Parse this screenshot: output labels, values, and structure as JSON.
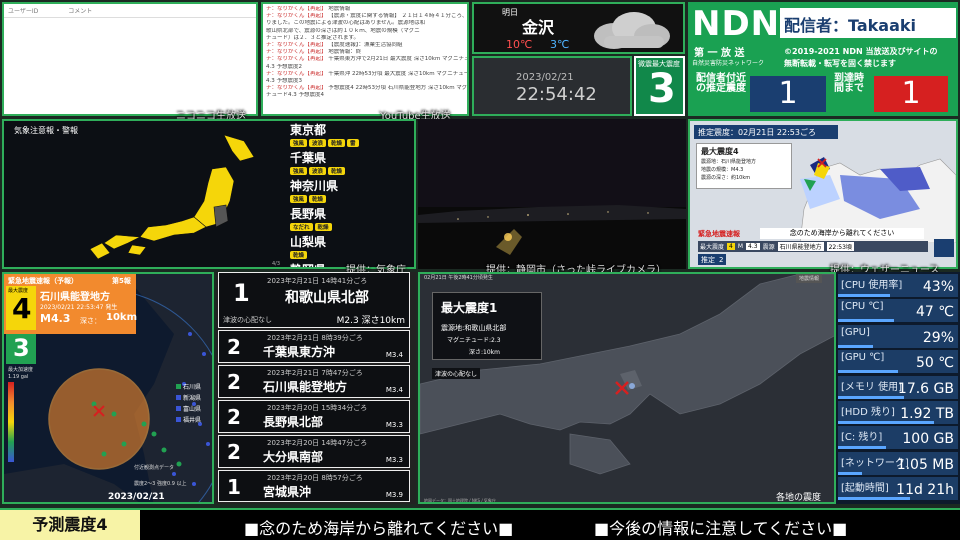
{
  "colors": {
    "frame": "#2fae5a",
    "ndn_green": "#1aa152",
    "alert_red": "#d62020",
    "quake_yellow": "#f5d60a",
    "navy": "#1a3e70"
  },
  "niconico": {
    "col_user": "ユーザーID",
    "col_comment": "コメント",
    "label": "ニコニコ生放送"
  },
  "youtube": {
    "label": "YouTube生放送",
    "messages": [
      {
        "who": "ナ：なりかくん【再起】",
        "msg": "地震情報"
      },
      {
        "who": "ナ：なりかくん【再起】",
        "msg": "【震源・震度に関する情報】 ２１日１４時４１分ごろ、地震があ"
      },
      {
        "who": "",
        "msg": "りました。この地震による津波の心配はありません。震源地は和"
      },
      {
        "who": "",
        "msg": "歌山県北部で、震源の深さは約１０ｋｍ、地震の規模（マグニ"
      },
      {
        "who": "",
        "msg": "チュード）は２．３と推定されます。"
      },
      {
        "who": "ナ：なりかくん【再起】",
        "msg": "【震度速報】：漁業生活協同組"
      },
      {
        "who": "ナ：なりかくん【再起】",
        "msg": "地震情報：終"
      },
      {
        "who": "ナ：なりかくん【再起】",
        "msg": "千葉県東方沖で2月21日 最大震度 深さ10km マグニチュード"
      },
      {
        "who": "",
        "msg": "4.3 予想震度2"
      },
      {
        "who": "ナ：なりかくん【再起】",
        "msg": "千葉県沖 22時53分頃 最大震度 深さ10km マグニチュード"
      },
      {
        "who": "",
        "msg": "4.3 予想震度3"
      },
      {
        "who": "ナ：なりかくん【再起】",
        "msg": "予想震度4 22時53分頃 石川県能登地方 深さ10km マグニ"
      },
      {
        "who": "",
        "msg": "チュード4.3 予想震度4"
      }
    ]
  },
  "weather": {
    "label": "明日",
    "city": "金沢",
    "high": "10℃",
    "low": "3℃"
  },
  "clock": {
    "date": "2023/02/21",
    "time": "22:54:42",
    "seismic_label": "微震最大震度",
    "seismic_value": "3"
  },
  "ndn": {
    "logo": "NDN",
    "broadcaster": "配信者：Takaaki",
    "subtitle": "第 一 放 送",
    "network": "自然災害防災ネットワーク",
    "copyright_1": "©2019-2021 NDN 当放送及びサイトの",
    "copyright_2": "無断転載・転写を固く禁じます",
    "near_label": "配信者付近の推定震度",
    "near_value": "1",
    "arrival_label": "到達時間まで",
    "arrival_value": "1"
  },
  "jma_map": {
    "title": "気象注意報・警報",
    "page": "4/3",
    "credit": "提供：気象庁",
    "prefs": [
      {
        "name": "東京都",
        "chips": [
          "強風",
          "波浪",
          "乾燥",
          "雷"
        ]
      },
      {
        "name": "千葉県",
        "chips": [
          "強風",
          "波浪",
          "乾燥"
        ]
      },
      {
        "name": "神奈川県",
        "chips": [
          "強風",
          "乾燥"
        ]
      },
      {
        "name": "長野県",
        "chips": [
          "なだれ",
          "乾燥"
        ]
      },
      {
        "name": "山梨県",
        "chips": [
          "乾燥"
        ]
      },
      {
        "name": "静岡県",
        "chips": [
          "乾燥"
        ]
      }
    ]
  },
  "live_camera": {
    "credit": "提供：静岡市（さった峠ライブカメラ）"
  },
  "weathernews": {
    "header": "推定震度：02月21日 22:53ごろ",
    "max_label": "最大震度4",
    "epicenter": "震源地：石川県能登地方",
    "magnitude": "地震の規模：M4.3",
    "depth": "震源の深さ：約10km",
    "alert_label": "緊急地震速報",
    "banner": "念のため海岸から離れてください",
    "row_label": "最大震度",
    "row_int": "4",
    "row_mag": "M",
    "row_mag_val": "4.3",
    "row_src": "震源",
    "row_place": "石川県能登地方",
    "row_time": "22:53頃",
    "est_label": "推定",
    "est_value": "2",
    "credit": "提供：ウェザーニュース"
  },
  "eew": {
    "title": "緊急地震速報（予報）",
    "report": "第5報",
    "max_label": "最大震度",
    "max_value": "4",
    "place": "石川県能登地方",
    "time": "2023/02/21 22:53:47 発生",
    "mag": "M4.3",
    "depth_label": "深さ：",
    "depth_value": "10km",
    "sub_value": "3",
    "accel_label": "最大加速度",
    "accel_value": "1.19 gal",
    "stations": [
      "石川県",
      "新潟県",
      "富山県",
      "福井県"
    ],
    "footer_time": "2023/02/21 22:54:18",
    "legend": "付近観測点データ",
    "legend2": "震度2～3 強度0.9 以上"
  },
  "quake_list": [
    {
      "int": "1",
      "dt": "2023年2月21日 14時41分ごろ",
      "place": "和歌山県北部",
      "note": "津波の心配なし",
      "mag": "M2.3 深さ10km",
      "big": true
    },
    {
      "int": "2",
      "dt": "2023年2月21日 8時39分ごろ",
      "place": "千葉県東方沖",
      "mag": "M3.4"
    },
    {
      "int": "2",
      "dt": "2023年2月21日 7時47分ごろ",
      "place": "石川県能登地方",
      "mag": "M3.4"
    },
    {
      "int": "2",
      "dt": "2023年2月20日 15時34分ごろ",
      "place": "長野県北部",
      "mag": "M3.3"
    },
    {
      "int": "2",
      "dt": "2023年2月20日 14時47分ごろ",
      "place": "大分県南部",
      "mag": "M3.3"
    },
    {
      "int": "1",
      "dt": "2023年2月20日 8時57分ごろ",
      "place": "宮城県沖",
      "mag": "M3.9"
    }
  ],
  "quake_map": {
    "header": "02月21日 午後2時41分頃発生",
    "tab": "地震情報",
    "title": "最大震度1",
    "epicenter": "震源地:和歌山県北部",
    "magnitude": "マグニチュード:2.3",
    "depth": "深さ:10km",
    "tsunami": "津波の心配なし",
    "footer": "各地の震度",
    "footer_small": "地図データ：国土地理院 / NKS / 気象庁"
  },
  "stats": [
    {
      "label": "[CPU 使用率]",
      "value": "43%",
      "fill": 0.43
    },
    {
      "label": "[CPU ℃]",
      "value": "47 ℃",
      "fill": 0.47
    },
    {
      "label": "[GPU]",
      "value": "29%",
      "fill": 0.29
    },
    {
      "label": "[GPU ℃]",
      "value": "50 ℃",
      "fill": 0.5
    },
    {
      "label": "[メモリ 使用]",
      "value": "17.6 GB",
      "fill": 0.55
    },
    {
      "label": "[HDD 残り]",
      "value": "1.92 TB",
      "fill": 0.8
    },
    {
      "label": "[C: 残り]",
      "value": "100 GB",
      "fill": 0.4
    },
    {
      "label": "[ネットワーク]",
      "value": "1.05 MB",
      "fill": 0.2
    },
    {
      "label": "[起動時間]",
      "value": "11d 21h",
      "fill": 0.6
    }
  ],
  "ticker": {
    "label": "予測震度4",
    "msg1": "■念のため海岸から離れてください■",
    "msg2": "■今後の情報に注意してください■"
  }
}
